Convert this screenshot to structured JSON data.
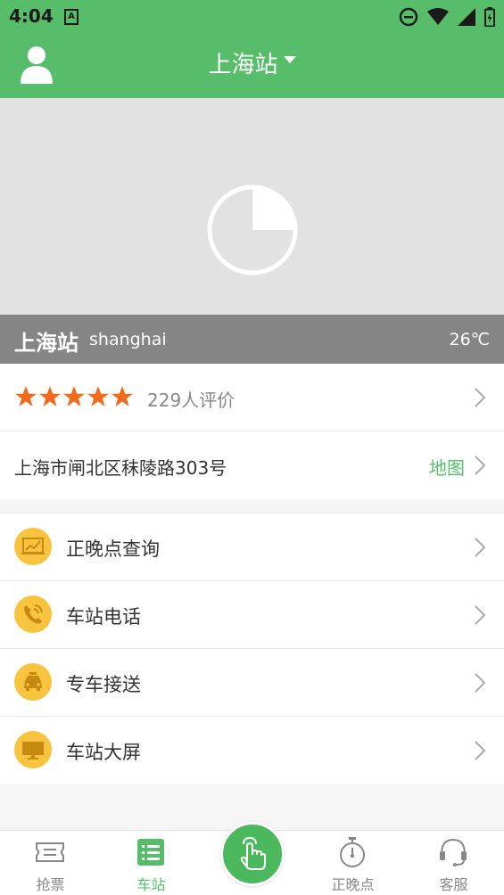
{
  "status_bar": {
    "time": "4:04",
    "notification_badge": "A"
  },
  "header": {
    "station_name": "上海站"
  },
  "hero": {
    "station_name": "上海站",
    "pinyin": "shanghai",
    "temperature": "26℃"
  },
  "rating": {
    "stars": 5,
    "count_text": "229人评价"
  },
  "address": {
    "text": "上海市闸北区秣陵路303号",
    "map_label": "地图"
  },
  "menu": {
    "items": [
      {
        "label": "正晚点查询",
        "icon": "chart-icon"
      },
      {
        "label": "车站电话",
        "icon": "phone-icon"
      },
      {
        "label": "专车接送",
        "icon": "taxi-icon"
      },
      {
        "label": "车站大屏",
        "icon": "monitor-icon"
      }
    ]
  },
  "tabbar": {
    "tabs": [
      {
        "label": "抢票",
        "icon": "ticket-icon"
      },
      {
        "label": "车站",
        "icon": "list-icon"
      },
      {
        "label": "正晚点",
        "icon": "stopwatch-icon"
      },
      {
        "label": "客服",
        "icon": "headset-icon"
      }
    ],
    "active": "车站",
    "center_icon": "tap-hand-icon"
  },
  "colors": {
    "primary": "#58bd6b",
    "star": "#f26a1b",
    "menu_icon_bg": "#f8c33f",
    "hero_bar": "#858585"
  }
}
